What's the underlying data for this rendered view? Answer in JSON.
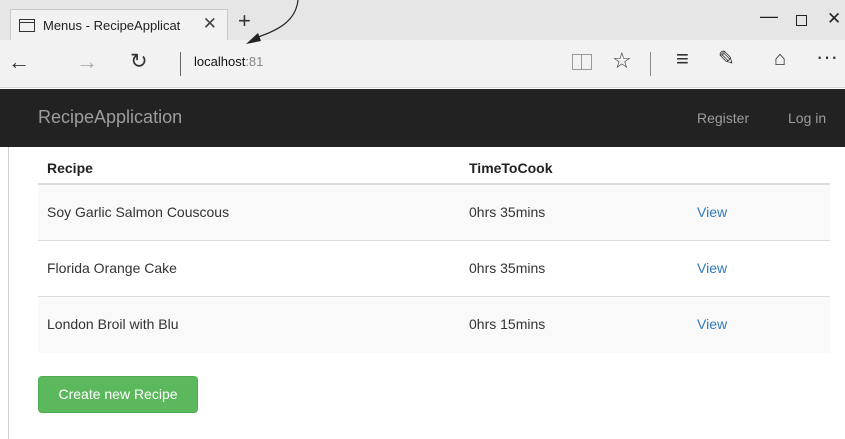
{
  "browser": {
    "tab_title": "Menus - RecipeApplicat",
    "tab_close": "✕",
    "new_tab": "+",
    "minimize": "—",
    "close": "✕",
    "back": "←",
    "forward": "→",
    "refresh": "↻",
    "address_host": "localhost",
    "address_port": ":81",
    "favorite": "☆",
    "hub": "≡",
    "note": "✎",
    "share": "⌂",
    "more": "···"
  },
  "site": {
    "brand": "RecipeApplication",
    "nav": {
      "register": "Register",
      "login": "Log in"
    }
  },
  "table": {
    "headers": [
      "Recipe",
      "TimeToCook",
      ""
    ],
    "rows": [
      {
        "recipe": "Soy Garlic Salmon Couscous",
        "time": "0hrs 35mins",
        "action": "View"
      },
      {
        "recipe": "Florida Orange Cake",
        "time": "0hrs 35mins",
        "action": "View"
      },
      {
        "recipe": "London Broil with Blu",
        "time": "0hrs 15mins",
        "action": "View"
      }
    ]
  },
  "create_button": "Create new Recipe"
}
